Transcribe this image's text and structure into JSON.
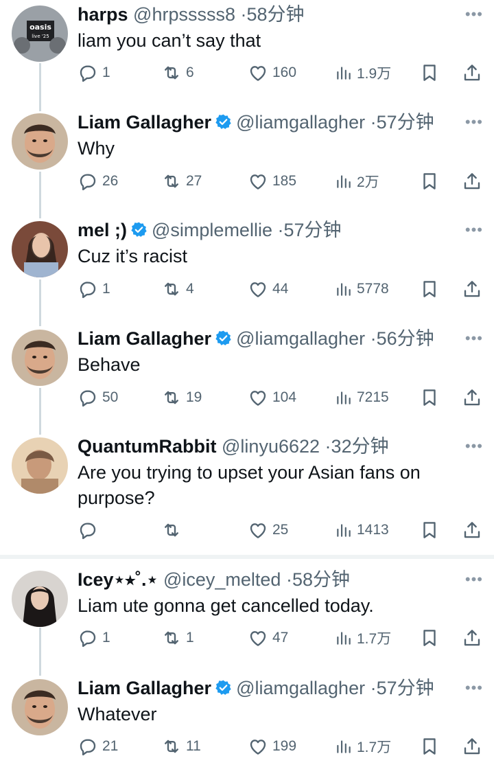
{
  "tweets": [
    {
      "name": "harps",
      "verified": false,
      "handle": "@hrpsssss8",
      "time": "58分钟",
      "text": "liam you can’t say that",
      "replies": "1",
      "retweets": "6",
      "likes": "160",
      "views": "1.9万",
      "avatar_text": "oasis live '25"
    },
    {
      "name": "Liam Gallagher",
      "verified": true,
      "handle": "@liamgallagher",
      "time": "57分钟",
      "text": "Why",
      "replies": "26",
      "retweets": "27",
      "likes": "185",
      "views": "2万"
    },
    {
      "name": "mel ;)",
      "verified": true,
      "handle": "@simplemellie",
      "time": "57分钟",
      "text": "Cuz it’s racist",
      "replies": "1",
      "retweets": "4",
      "likes": "44",
      "views": "5778"
    },
    {
      "name": "Liam Gallagher",
      "verified": true,
      "handle": "@liamgallagher",
      "time": "56分钟",
      "text": "Behave",
      "replies": "50",
      "retweets": "19",
      "likes": "104",
      "views": "7215"
    },
    {
      "name": "QuantumRabbit",
      "verified": false,
      "handle": "@linyu6622",
      "time": "32分钟",
      "text": "Are you trying to upset your Asian fans on purpose?",
      "replies": "",
      "retweets": "",
      "likes": "25",
      "views": "1413"
    },
    {
      "name": "Icey⋆⭒˚.⋆",
      "verified": false,
      "handle": "@icey_melted",
      "time": "58分钟",
      "text": "Liam ute gonna get cancelled today.",
      "replies": "1",
      "retweets": "1",
      "likes": "47",
      "views": "1.7万"
    },
    {
      "name": "Liam Gallagher",
      "verified": true,
      "handle": "@liamgallagher",
      "time": "57分钟",
      "text": "Whatever",
      "replies": "21",
      "retweets": "11",
      "likes": "199",
      "views": "1.7万"
    }
  ],
  "icons": {
    "reply": "reply-icon",
    "retweet": "retweet-icon",
    "like": "heart-icon",
    "views": "views-icon",
    "bookmark": "bookmark-icon",
    "share": "share-icon",
    "more": "more-icon",
    "verified": "verified-badge-icon"
  },
  "colors": {
    "verified": "#1d9bf0",
    "muted": "#536471",
    "text": "#0f1419",
    "thread_line": "#cfd9de"
  }
}
